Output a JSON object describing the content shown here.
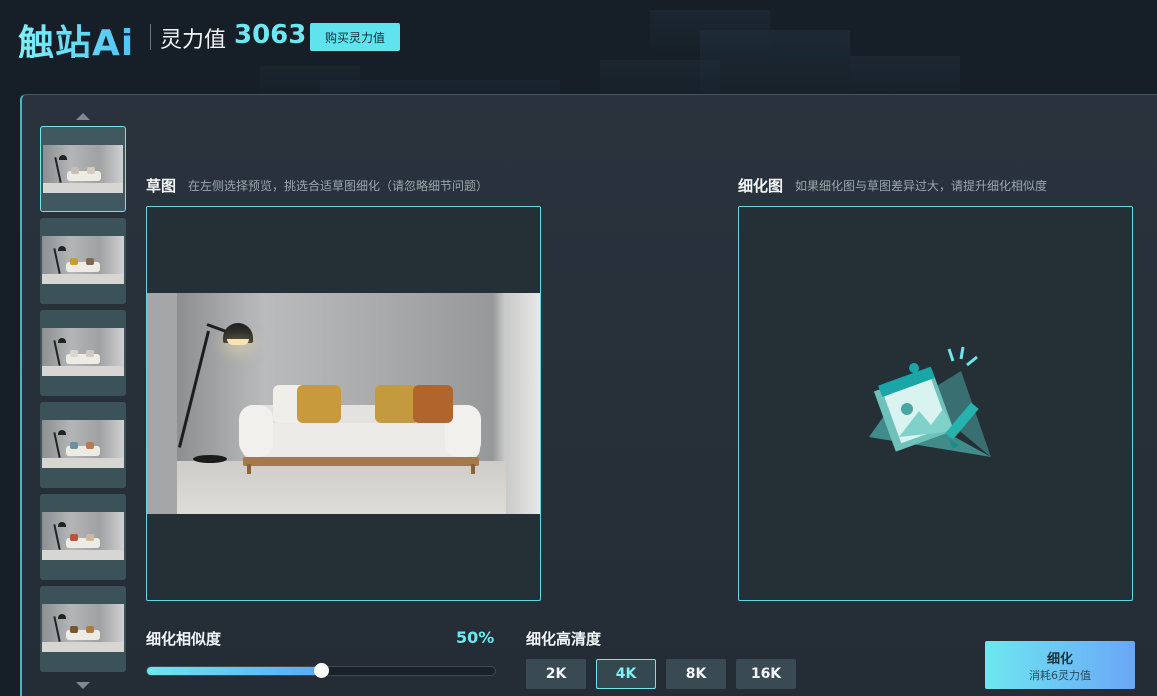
{
  "header": {
    "logo": "触站Ai",
    "power_label": "灵力值",
    "power_value": "3063",
    "buy_button": "购买灵力值"
  },
  "thumbnails": {
    "items": [
      {
        "label": "thumbnail-1",
        "pillow_colors": [
          "#c7c0b4",
          "#d2cbbf"
        ]
      },
      {
        "label": "thumbnail-2",
        "pillow_colors": [
          "#c99a3c",
          "#7d6a4e"
        ]
      },
      {
        "label": "thumbnail-3",
        "pillow_colors": [
          "#d9d6cf",
          "#cfcbc2"
        ]
      },
      {
        "label": "thumbnail-4",
        "pillow_colors": [
          "#6a8fa0",
          "#b67a55"
        ]
      },
      {
        "label": "thumbnail-5",
        "pillow_colors": [
          "#b5553e",
          "#cdb9a0"
        ]
      },
      {
        "label": "thumbnail-6",
        "pillow_colors": [
          "#7a5634",
          "#b07a43"
        ]
      }
    ],
    "active_index": 0
  },
  "sketch": {
    "title": "草图",
    "hint": "在左侧选择预览，挑选合适草图细化（请忽略细节问题）"
  },
  "refined": {
    "title": "细化图",
    "hint": "如果细化图与草图差异过大，请提升细化相似度"
  },
  "similarity": {
    "label": "细化相似度",
    "value_text": "50%",
    "value": 0.5
  },
  "resolution": {
    "label": "细化高清度",
    "options": [
      "2K",
      "4K",
      "8K",
      "16K"
    ],
    "selected": "4K"
  },
  "refine_button": {
    "label": "细化",
    "cost": "消耗6灵力值"
  },
  "colors": {
    "accent": "#6ee7f0",
    "accent_blue": "#6aa6f7",
    "panel_bg": "#2a333d"
  }
}
